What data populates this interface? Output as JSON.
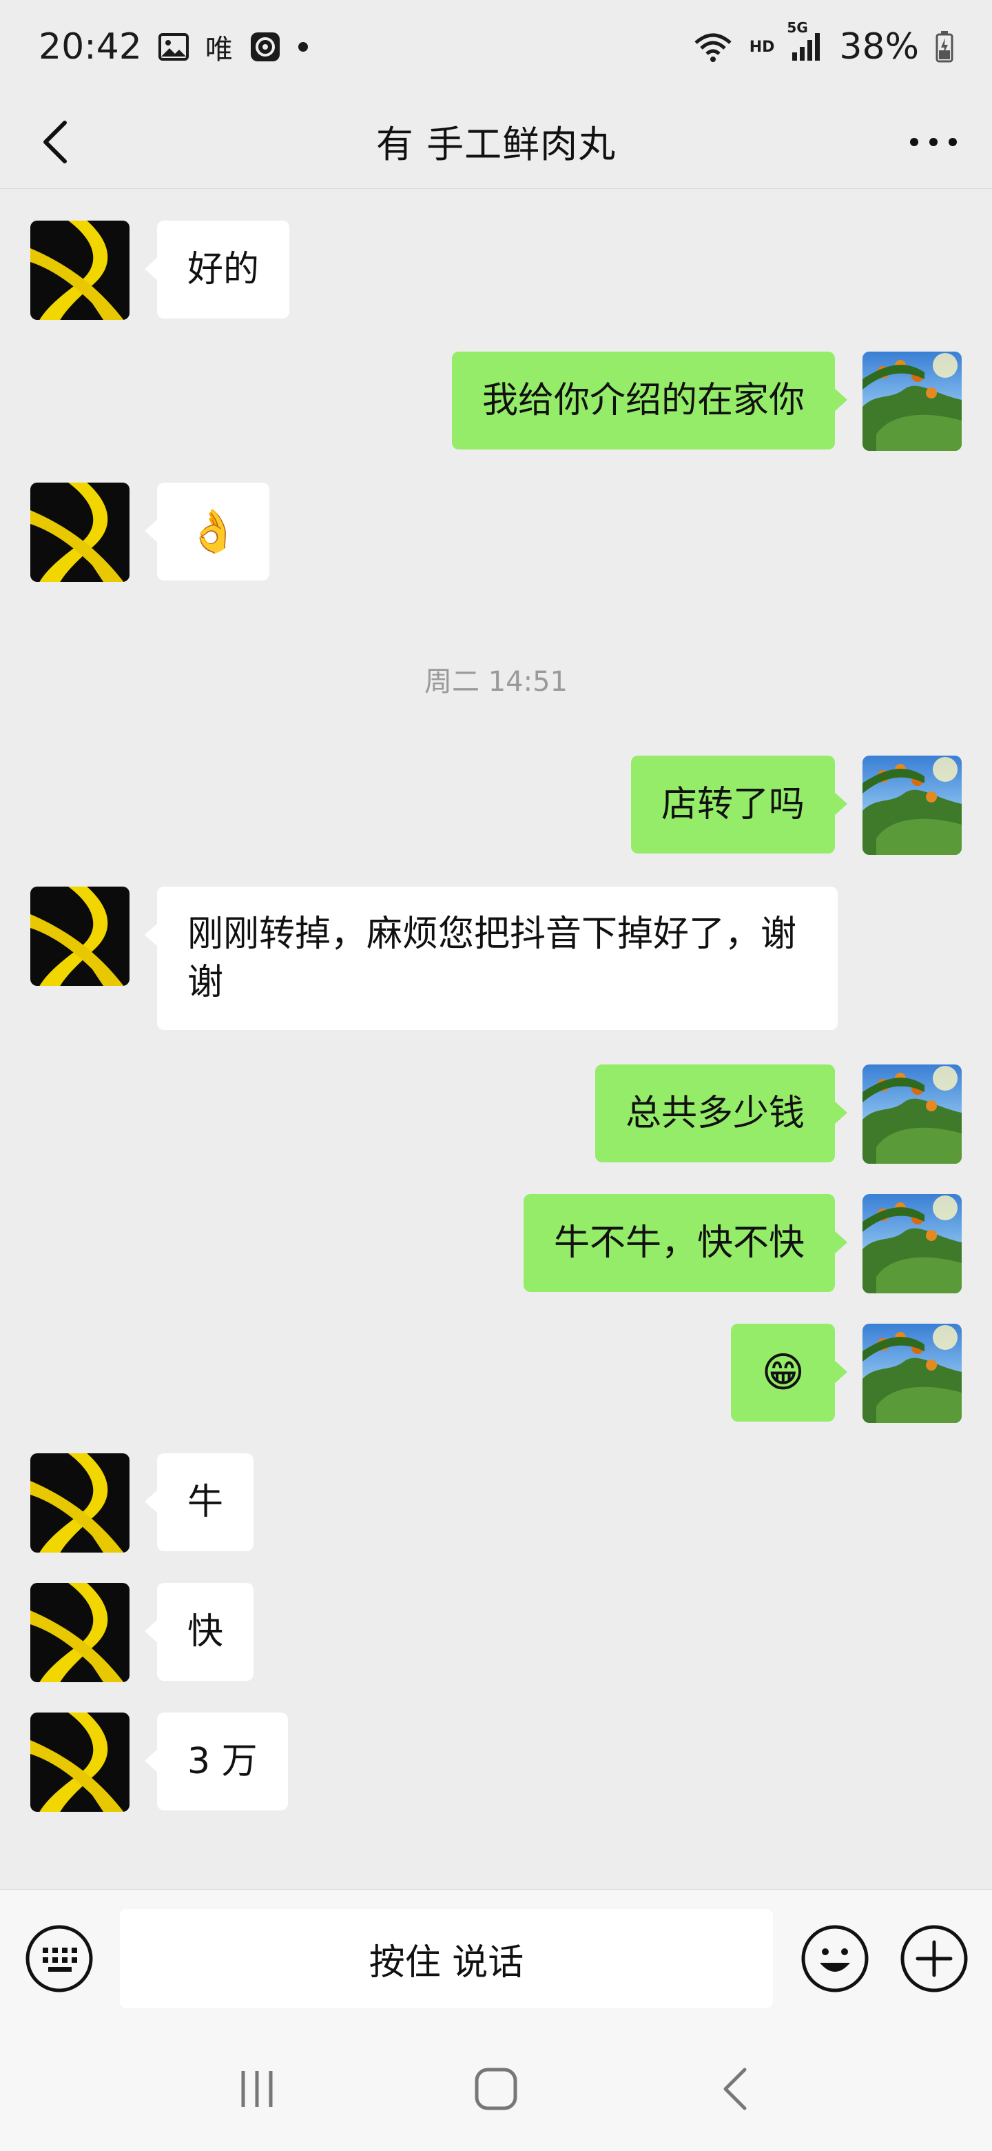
{
  "status_bar": {
    "time": "20:42",
    "carrier_text": "唯",
    "network_hd": "HD",
    "network_5g": "5G",
    "battery": "38%"
  },
  "header": {
    "title": "有 手工鲜肉丸"
  },
  "messages": [
    {
      "side": "left",
      "text": "好的"
    },
    {
      "side": "right",
      "text": "我给你介绍的在家你"
    },
    {
      "side": "left",
      "text": "👌"
    },
    {
      "type": "time",
      "text": "周二 14:51"
    },
    {
      "side": "right",
      "text": "店转了吗"
    },
    {
      "side": "left",
      "text": "刚刚转掉，麻烦您把抖音下掉好了，谢谢"
    },
    {
      "side": "right",
      "text": "总共多少钱"
    },
    {
      "side": "right",
      "text": "牛不牛，快不快"
    },
    {
      "side": "right",
      "text": "😁"
    },
    {
      "side": "left",
      "text": "牛"
    },
    {
      "side": "left",
      "text": "快"
    },
    {
      "side": "left",
      "text": "3 万"
    }
  ],
  "input_bar": {
    "voice_label": "按住 说话"
  },
  "colors": {
    "background": "#ededed",
    "sent_bubble": "#95ec69",
    "received_bubble": "#ffffff"
  }
}
